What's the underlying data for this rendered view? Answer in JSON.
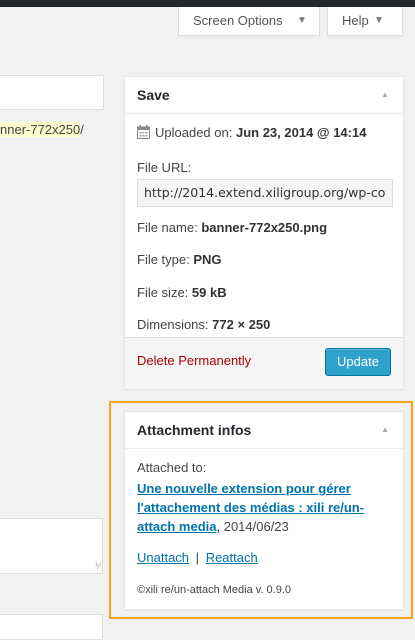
{
  "header": {
    "screen_options": "Screen Options",
    "help": "Help"
  },
  "editor": {
    "permalink_suffix": "nner-772x250",
    "permalink_end": "/"
  },
  "save_box": {
    "title": "Save",
    "uploaded_label": "Uploaded on:",
    "uploaded_value": "Jun 23, 2014 @ 14:14",
    "file_url_label": "File URL:",
    "file_url_value": "http://2014.extend.xiligroup.org/wp-co",
    "file_name_label": "File name:",
    "file_name_value": "banner-772x250.png",
    "file_type_label": "File type:",
    "file_type_value": "PNG",
    "file_size_label": "File size:",
    "file_size_value": "59 kB",
    "dimensions_label": "Dimensions:",
    "dimensions_value": "772 × 250",
    "delete_label": "Delete Permanently",
    "update_label": "Update"
  },
  "attachment_box": {
    "title": "Attachment infos",
    "attached_to_label": "Attached to:",
    "post_link_line1": "Une nouvelle extension pour gérer",
    "post_link_line2": "l'attachement des médias : xili re/un-",
    "post_link_line3": "attach media",
    "post_date": ", 2014/06/23",
    "unattach": "Unattach",
    "separator": "|",
    "reattach": "Reattach",
    "credit": "©xili re/un-attach Media v. 0.9.0"
  },
  "colors": {
    "highlight": "#f5a623",
    "link": "#0073aa",
    "delete": "#a00",
    "primary_button": "#2ea2cc"
  }
}
